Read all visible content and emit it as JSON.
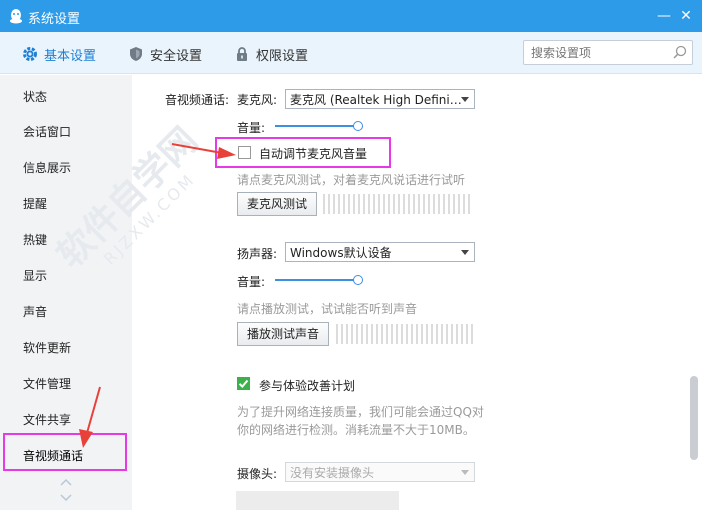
{
  "window": {
    "title": "系统设置",
    "minimize": "—",
    "close": "✕"
  },
  "tabs": [
    {
      "label": "基本设置",
      "icon": "gear-icon",
      "active": true
    },
    {
      "label": "安全设置",
      "icon": "shield-icon",
      "active": false
    },
    {
      "label": "权限设置",
      "icon": "lock-icon",
      "active": false
    }
  ],
  "search": {
    "placeholder": "搜索设置项",
    "icon": "search-icon"
  },
  "sidebar": {
    "items": [
      "状态",
      "会话窗口",
      "信息展示",
      "提醒",
      "热键",
      "显示",
      "声音",
      "软件更新",
      "文件管理",
      "文件共享",
      "音视频通话"
    ],
    "selected": "音视频通话"
  },
  "audio_video": {
    "section_label": "音视频通话:",
    "mic": {
      "label": "麦克风:",
      "device": "麦克风 (Realtek High Defini…",
      "volume_label": "音量:",
      "volume_level": 1.0,
      "auto_adjust_label": "自动调节麦克风音量",
      "auto_adjust_checked": false,
      "test_hint": "请点麦克风测试，对着麦克风说话进行试听",
      "test_button": "麦克风测试"
    },
    "speaker": {
      "label": "扬声器:",
      "device": "Windows默认设备",
      "volume_label": "音量:",
      "volume_level": 1.0,
      "test_hint": "请点播放测试，试试能否听到声音",
      "test_button": "播放测试声音"
    },
    "experience": {
      "label": "参与体验改善计划",
      "checked": true,
      "desc_line1": "为了提升网络连接质量，我们可能会通过QQ对",
      "desc_line2": "你的网络进行检测。消耗流量不大于10MB。"
    },
    "camera": {
      "label": "摄像头:",
      "device": "没有安装摄像头"
    }
  },
  "watermark": "软件自学网 RJZXW.COM",
  "colors": {
    "titlebar": "#2e9be9",
    "accent": "#1e7fd4",
    "highlight": "#e63ae6",
    "arrow": "#e8413a",
    "check": "#3cb04a"
  }
}
